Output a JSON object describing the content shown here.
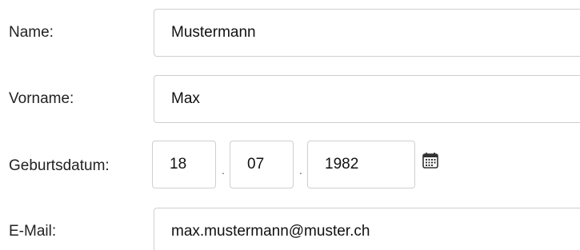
{
  "form": {
    "name": {
      "label": "Name:",
      "value": "Mustermann"
    },
    "vorname": {
      "label": "Vorname:",
      "value": "Max"
    },
    "geburtsdatum": {
      "label": "Geburtsdatum:",
      "day": "18",
      "separator1": ".",
      "month": "07",
      "separator2": ".",
      "year": "1982",
      "icon": "calendar-icon"
    },
    "email": {
      "label": "E-Mail:",
      "value": "max.mustermann@muster.ch"
    }
  }
}
